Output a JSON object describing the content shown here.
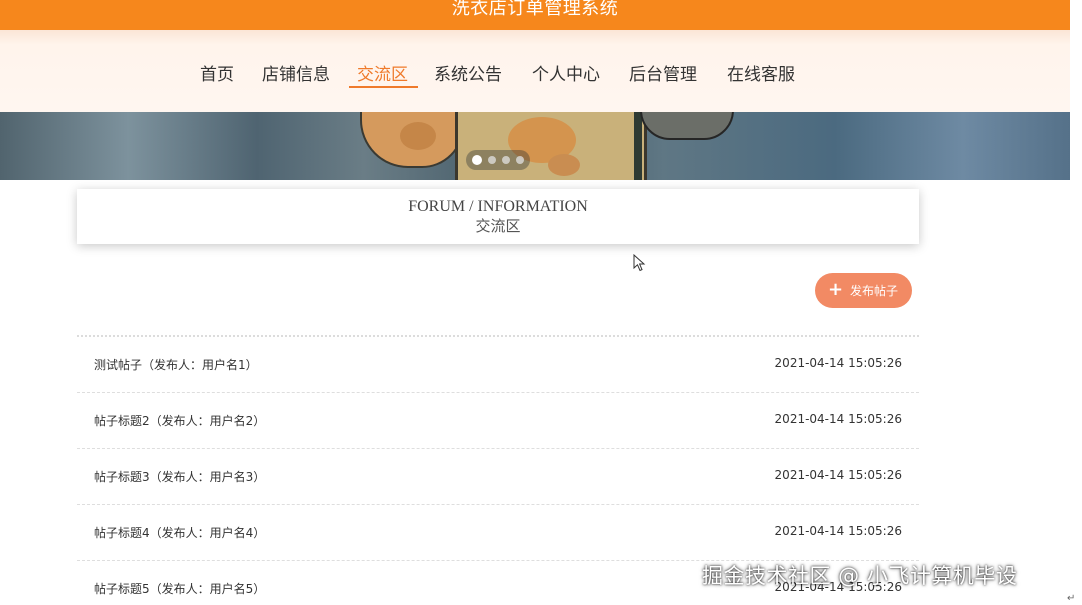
{
  "header": {
    "site_title": "洗衣店订单管理系统"
  },
  "nav": {
    "items": [
      {
        "label": "首页",
        "active": false
      },
      {
        "label": "店铺信息",
        "active": false
      },
      {
        "label": "交流区",
        "active": true
      },
      {
        "label": "系统公告",
        "active": false
      },
      {
        "label": "个人中心",
        "active": false
      },
      {
        "label": "后台管理",
        "active": false
      },
      {
        "label": "在线客服",
        "active": false
      }
    ],
    "accent_color": "#ef7a2b"
  },
  "banner": {
    "slide_count": 4,
    "active_slide": 1
  },
  "section": {
    "title_en": "FORUM / INFORMATION",
    "title_cn": "交流区"
  },
  "actions": {
    "post_button_label": "发布帖子",
    "post_button_icon": "plus-icon"
  },
  "posts": [
    {
      "title": "测试帖子（发布人：用户名1）",
      "time": "2021-04-14 15:05:26"
    },
    {
      "title": "帖子标题2（发布人：用户名2）",
      "time": "2021-04-14 15:05:26"
    },
    {
      "title": "帖子标题3（发布人：用户名3）",
      "time": "2021-04-14 15:05:26"
    },
    {
      "title": "帖子标题4（发布人：用户名4）",
      "time": "2021-04-14 15:05:26"
    },
    {
      "title": "帖子标题5（发布人：用户名5）",
      "time": "2021-04-14 15:05:26"
    }
  ],
  "watermark": "掘金技术社区 @ 小飞计算机毕设",
  "corner_mark": "↵",
  "colors": {
    "top_bar": "#f6871c",
    "post_button": "#f28a64"
  }
}
